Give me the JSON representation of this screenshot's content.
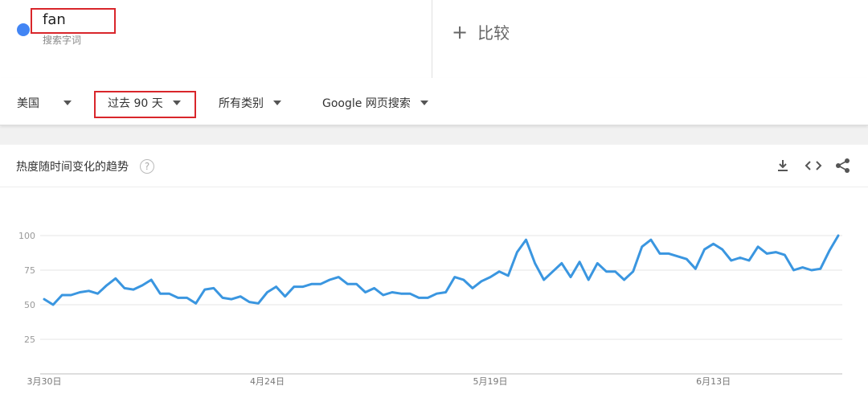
{
  "search": {
    "term": "fan",
    "term_sub": "搜索字词",
    "compare_plus": "+",
    "compare_label": "比较",
    "term_color": "#4285f4",
    "highlight_color": "#d9262b"
  },
  "filters": {
    "region": "美国",
    "timeframe": "过去 90 天",
    "category": "所有类别",
    "property": "Google 网页搜索"
  },
  "card": {
    "title": "热度随时间变化的趋势",
    "help_icon": "?",
    "icons": [
      "download-icon",
      "embed-icon",
      "share-icon"
    ]
  },
  "chart_data": {
    "type": "line",
    "ylim": [
      0,
      100
    ],
    "y_ticks": [
      25,
      50,
      75,
      100
    ],
    "x_labels": [
      "3月30日",
      "4月24日",
      "5月19日",
      "6月13日"
    ],
    "x_label_index": [
      0,
      25,
      50,
      75
    ],
    "line_color": "#3a96e0",
    "grid": true,
    "series": [
      {
        "values": [
          54,
          50,
          57,
          57,
          59,
          60,
          58,
          64,
          69,
          62,
          61,
          64,
          68,
          58,
          58,
          55,
          55,
          51,
          61,
          62,
          55,
          54,
          56,
          52,
          51,
          59,
          63,
          56,
          63,
          63,
          65,
          65,
          68,
          70,
          65,
          65,
          59,
          62,
          57,
          59,
          58,
          58,
          55,
          55,
          58,
          59,
          70,
          68,
          62,
          67,
          70,
          74,
          71,
          88,
          97,
          80,
          68,
          74,
          80,
          70,
          81,
          68,
          80,
          74,
          74,
          68,
          74,
          92,
          97,
          87,
          87,
          85,
          83,
          76,
          90,
          94,
          90,
          82,
          84,
          82,
          92,
          87,
          88,
          86,
          75,
          77,
          75,
          76,
          89,
          100
        ]
      }
    ]
  }
}
